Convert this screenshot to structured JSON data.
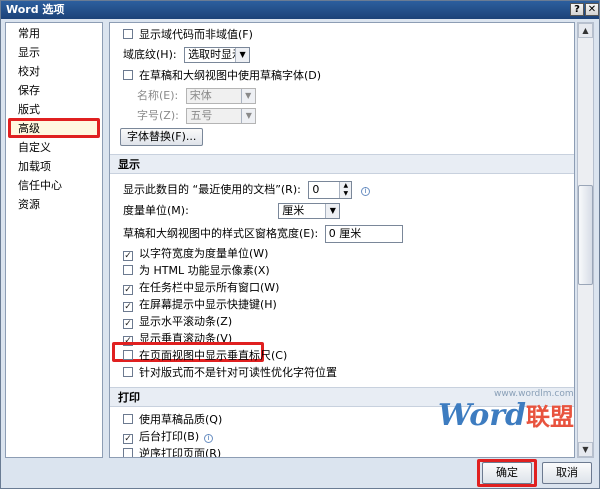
{
  "window": {
    "title": "Word 选项",
    "help_glyph": "?",
    "close_glyph": "✕"
  },
  "sidebar": {
    "items": [
      {
        "label": "常用"
      },
      {
        "label": "显示"
      },
      {
        "label": "校对"
      },
      {
        "label": "保存"
      },
      {
        "label": "版式"
      },
      {
        "label": "高级"
      },
      {
        "label": "自定义"
      },
      {
        "label": "加载项"
      },
      {
        "label": "信任中心"
      },
      {
        "label": "资源"
      }
    ],
    "selected": "高级"
  },
  "content": {
    "show_field_codes": {
      "label": "显示域代码而非域值(F)",
      "checked": false
    },
    "field_shading": {
      "label": "域底纹(H):",
      "value": "选取时显示"
    },
    "draft_font": {
      "label": "在草稿和大纲视图中使用草稿字体(D)",
      "checked": false
    },
    "font_name": {
      "label": "名称(E):",
      "value": "宋体"
    },
    "font_size": {
      "label": "字号(Z):",
      "value": "五号"
    },
    "font_substitution": {
      "label": "字体替换(F)..."
    },
    "display_section": {
      "title": "显示"
    },
    "recent_docs": {
      "label": "显示此数目的 “最近使用的文档”(R):",
      "value": "0"
    },
    "measure_unit": {
      "label": "度量单位(M):",
      "value": "厘米"
    },
    "style_area_width": {
      "label": "草稿和大纲视图中的样式区窗格宽度(E):",
      "value": "0 厘米"
    },
    "options": [
      {
        "label": "以字符宽度为度量单位(W)",
        "checked": true
      },
      {
        "label": "为 HTML 功能显示像素(X)",
        "checked": false
      },
      {
        "label": "在任务栏中显示所有窗口(W)",
        "checked": true
      },
      {
        "label": "在屏幕提示中显示快捷键(H)",
        "checked": true
      },
      {
        "label": "显示水平滚动条(Z)",
        "checked": true
      },
      {
        "label": "显示垂直滚动条(V)",
        "checked": true
      },
      {
        "label": "在页面视图中显示垂直标尺(C)",
        "checked": false
      },
      {
        "label": "针对版式而不是针对可读性优化字符位置",
        "checked": false
      }
    ],
    "print_section": {
      "title": "打印"
    },
    "print_options": [
      {
        "label": "使用草稿品质(Q)",
        "checked": false
      },
      {
        "label": "后台打印(B)",
        "checked": true
      },
      {
        "label": "逆序打印页面(R)",
        "checked": false
      }
    ]
  },
  "watermark": {
    "url": "www.wordlm.com",
    "logo_main": "Word",
    "logo_cn": "联盟"
  },
  "footer": {
    "ok_label": "确定",
    "cancel_label": "取消"
  },
  "icons": {
    "checkmark": "✓",
    "dropdown": "▼",
    "spin_up": "▲",
    "spin_down": "▼",
    "info": "i"
  },
  "colors": {
    "highlight": "#e02020",
    "title_bar": "#1c4278",
    "section_bg": "#e8edf4"
  }
}
